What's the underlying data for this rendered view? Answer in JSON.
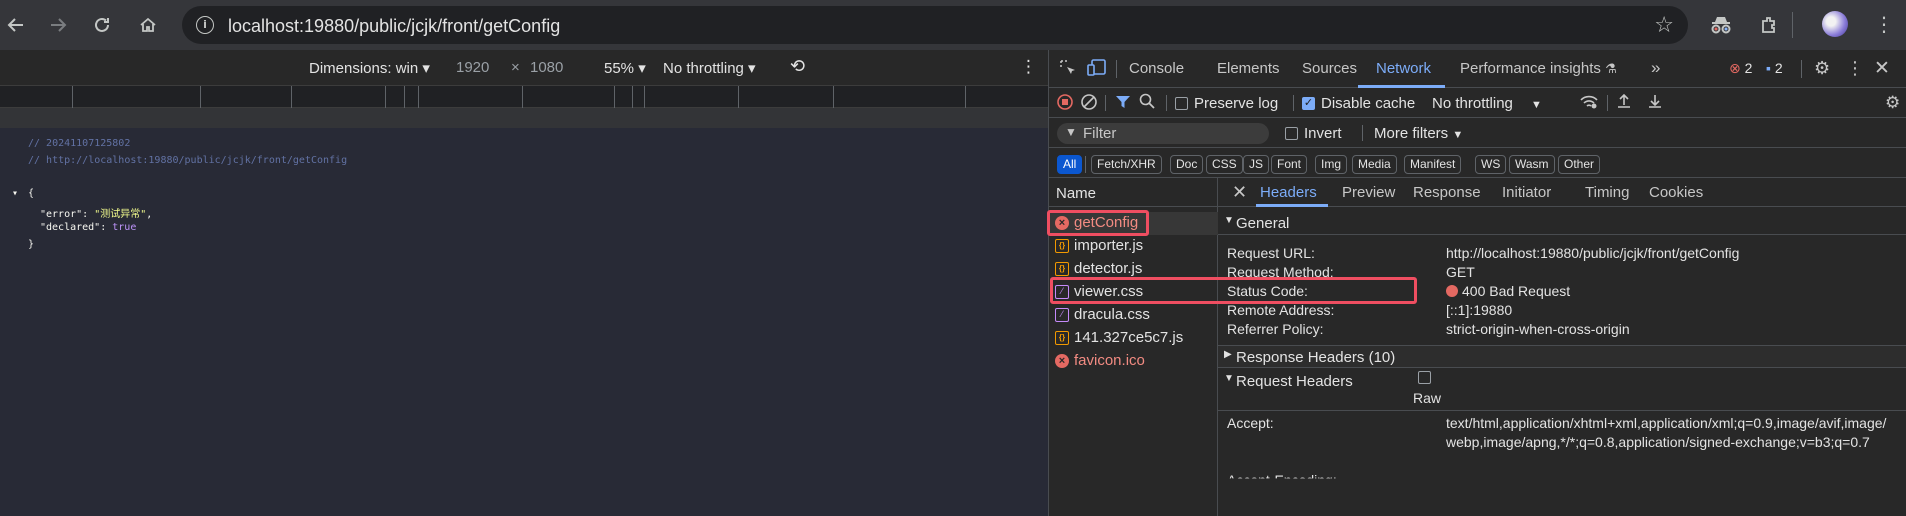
{
  "browser": {
    "url": "localhost:19880/public/jcjk/front/getConfig",
    "icons": [
      "back-icon",
      "forward-icon",
      "reload-icon",
      "home-icon",
      "site-info-icon",
      "bookmark-star-icon",
      "incognito-icon",
      "extensions-icon",
      "profile-avatar"
    ]
  },
  "device_toolbar": {
    "dimensions_label": "Dimensions: win",
    "width": "1920",
    "times": "×",
    "height": "1080",
    "zoom": "55%",
    "throttling": "No throttling"
  },
  "page": {
    "lines": [
      {
        "type": "comment",
        "text": "// 20241107125802"
      },
      {
        "type": "comment",
        "text": "// http://localhost:19880/public/jcjk/front/getConfig"
      },
      {
        "type": "brace",
        "text": "{"
      },
      {
        "type": "kv",
        "key": "\"error\"",
        "sep": ": ",
        "val": "\"测试异常\"",
        "end": ",",
        "val_type": "str"
      },
      {
        "type": "kv",
        "key": "\"declared\"",
        "sep": ": ",
        "val": "true",
        "end": "",
        "val_type": "bool"
      },
      {
        "type": "brace",
        "text": "}"
      }
    ]
  },
  "devtools": {
    "tabs": [
      "Console",
      "Elements",
      "Sources",
      "Network",
      "Performance insights"
    ],
    "active_tab": "Network",
    "more_tabs": "»",
    "error_count": "2",
    "message_count": "2",
    "network_toolbar": {
      "preserve_log": "Preserve log",
      "disable_cache": "Disable cache",
      "throttling": "No throttling"
    },
    "filter": {
      "placeholder": "Filter",
      "invert": "Invert",
      "more_filters": "More filters"
    },
    "type_filters": [
      "All",
      "Fetch/XHR",
      "Doc",
      "CSS",
      "JS",
      "Font",
      "Img",
      "Media",
      "Manifest",
      "WS",
      "Wasm",
      "Other"
    ],
    "name_header": "Name",
    "requests": [
      {
        "name": "getConfig",
        "kind": "err"
      },
      {
        "name": "importer.js",
        "kind": "js"
      },
      {
        "name": "detector.js",
        "kind": "js"
      },
      {
        "name": "viewer.css",
        "kind": "css"
      },
      {
        "name": "dracula.css",
        "kind": "css"
      },
      {
        "name": "141.327ce5c7.js",
        "kind": "js"
      },
      {
        "name": "favicon.ico",
        "kind": "err"
      }
    ],
    "detail_tabs": [
      "Headers",
      "Preview",
      "Response",
      "Initiator",
      "Timing",
      "Cookies"
    ],
    "general": {
      "title": "General",
      "rows": [
        {
          "key": "Request URL:",
          "val": "http://localhost:19880/public/jcjk/front/getConfig"
        },
        {
          "key": "Request Method:",
          "val": "GET"
        },
        {
          "key": "Status Code:",
          "val": "400 Bad Request"
        },
        {
          "key": "Remote Address:",
          "val": "[::1]:19880"
        },
        {
          "key": "Referrer Policy:",
          "val": "strict-origin-when-cross-origin"
        }
      ]
    },
    "response_headers": "Response Headers (10)",
    "request_headers": "Request Headers",
    "raw": "Raw",
    "accept_key": "Accept:",
    "accept_val": "text/html,application/xhtml+xml,application/xml;q=0.9,image/avif,image/webp,image/apng,*/*;q=0.8,application/signed-exchange;v=b3;q=0.7",
    "accept_encoding_key": "Accept-Encoding:",
    "colors": {
      "accent": "#7cacf8",
      "error": "#e46962",
      "highlight": "#ef4e61"
    }
  }
}
